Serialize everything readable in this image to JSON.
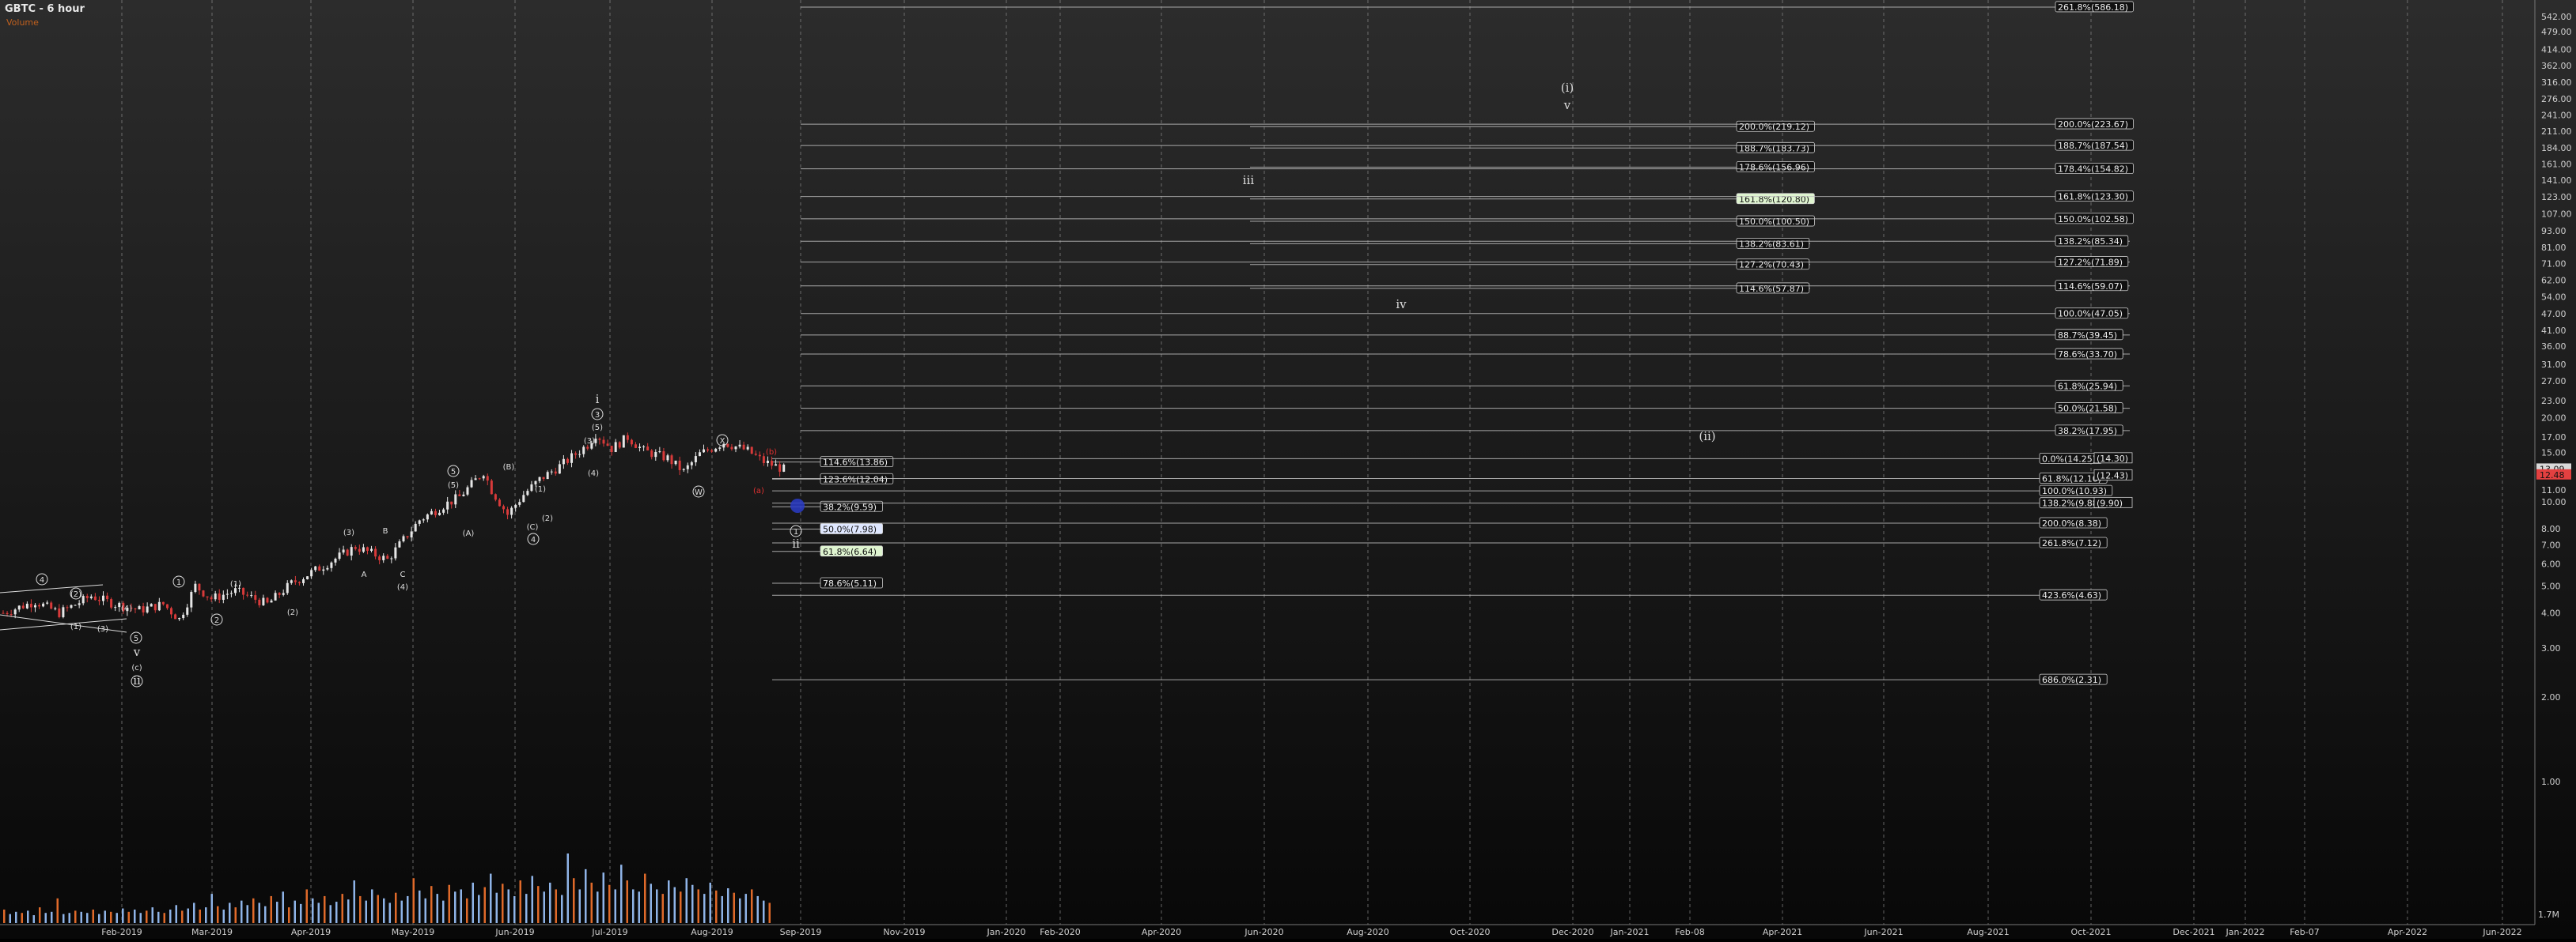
{
  "chart": {
    "title": "GBTC - 6 hour",
    "indicator_label": "Volume",
    "volume_readout": "1.7M"
  },
  "colors": {
    "background_top": "#2a2a2a",
    "background_bottom": "#0a0a0a",
    "grid": "#8a8a8a",
    "up_candle": "#e6e6e6",
    "down_candle": "#d83a3a",
    "volume_up": "#8fb4e8",
    "volume_down": "#e06a2a",
    "fib_line": "#bfbfbf",
    "label_bg": "#111111",
    "label_text": "#eeeeee",
    "highlight_green": "#dff5d0",
    "highlight_blue": "#dfe7ff",
    "wave_label": "#dddddd",
    "red_label": "#e03030",
    "price_tag_bg": "#d9d9d9"
  },
  "chart_data": {
    "type": "candlestick",
    "title": "GBTC - 6 hour",
    "y_scale": "log",
    "ylim": [
      0.9,
      586
    ],
    "x_tick_labels": [
      "Feb-2019",
      "Mar-2019",
      "Apr-2019",
      "May-2019",
      "Jun-2019",
      "Jul-2019",
      "Aug-2019",
      "Sep-2019",
      "Nov-2019",
      "Jan-2020",
      "Feb-2020",
      "Apr-2020",
      "Jun-2020",
      "Aug-2020",
      "Oct-2020",
      "Dec-2020",
      "Jan-2021",
      "Feb-08",
      "Apr-2021",
      "Jun-2021",
      "Aug-2021",
      "Oct-2021",
      "Dec-2021",
      "Jan-2022",
      "Feb-07",
      "Apr-2022",
      "Jun-2022"
    ],
    "y_tick_labels": [
      "542.00",
      "479.00",
      "414.00",
      "362.00",
      "316.00",
      "276.00",
      "241.00",
      "211.00",
      "184.00",
      "161.00",
      "141.00",
      "123.00",
      "107.00",
      "93.00",
      "81.00",
      "71.00",
      "62.00",
      "54.00",
      "47.00",
      "41.00",
      "36.00",
      "31.00",
      "27.00",
      "23.00",
      "20.00",
      "17.00",
      "15.00",
      "13.00",
      "11.00",
      "10.00",
      "8.00",
      "7.00",
      "6.00",
      "5.00",
      "4.00",
      "3.00",
      "2.00",
      "1.00"
    ],
    "y_tick_values": [
      542,
      479,
      414,
      362,
      316,
      276,
      241,
      211,
      184,
      161,
      141,
      123,
      107,
      93,
      81,
      71,
      62,
      54,
      47,
      41,
      36,
      31,
      27,
      23,
      20,
      17,
      15,
      13,
      11,
      10,
      8,
      7,
      6,
      5,
      4,
      3,
      2,
      1
    ],
    "price_path": [
      [
        0,
        4.0
      ],
      [
        8,
        4.4
      ],
      [
        14,
        4.0
      ],
      [
        22,
        4.6
      ],
      [
        28,
        4.3
      ],
      [
        34,
        4.1
      ],
      [
        40,
        4.3
      ],
      [
        44,
        3.8
      ],
      [
        48,
        5.0
      ],
      [
        52,
        4.5
      ],
      [
        58,
        4.8
      ],
      [
        66,
        4.3
      ],
      [
        72,
        5.1
      ],
      [
        80,
        5.9
      ],
      [
        88,
        6.9
      ],
      [
        96,
        6.2
      ],
      [
        104,
        8.6
      ],
      [
        110,
        9.7
      ],
      [
        114,
        10.4
      ],
      [
        120,
        12.8
      ],
      [
        122,
        11.0
      ],
      [
        126,
        9.0
      ],
      [
        130,
        10.6
      ],
      [
        134,
        12.0
      ],
      [
        140,
        13.7
      ],
      [
        146,
        16.0
      ],
      [
        148,
        17.5
      ],
      [
        152,
        15.5
      ],
      [
        156,
        17.0
      ],
      [
        160,
        15.2
      ],
      [
        166,
        14.3
      ],
      [
        170,
        12.8
      ],
      [
        174,
        14.8
      ],
      [
        180,
        16.3
      ],
      [
        186,
        15.2
      ],
      [
        190,
        13.9
      ],
      [
        196,
        12.9
      ]
    ],
    "volume": [
      12,
      8,
      10,
      9,
      11,
      7,
      14,
      9,
      10,
      22,
      8,
      9,
      11,
      10,
      9,
      12,
      8,
      11,
      10,
      9,
      13,
      10,
      12,
      9,
      11,
      14,
      10,
      9,
      12,
      16,
      11,
      13,
      18,
      12,
      14,
      26,
      15,
      12,
      18,
      14,
      20,
      16,
      22,
      18,
      15,
      24,
      19,
      28,
      14,
      20,
      17,
      30,
      22,
      18,
      24,
      16,
      19,
      26,
      21,
      38,
      24,
      20,
      30,
      25,
      22,
      18,
      27,
      20,
      24,
      40,
      29,
      22,
      33,
      26,
      20,
      34,
      28,
      30,
      22,
      36,
      25,
      32,
      44,
      27,
      35,
      30,
      24,
      38,
      26,
      42,
      33,
      28,
      36,
      30,
      25,
      62,
      40,
      30,
      48,
      36,
      28,
      45,
      34,
      30,
      52,
      38,
      30,
      28,
      44,
      35,
      30,
      26,
      38,
      32,
      28,
      40,
      34,
      30,
      26,
      36,
      29,
      24,
      31,
      27,
      22,
      26,
      30,
      24,
      20,
      18
    ],
    "fib_sets": [
      {
        "x_start_date": "Aug-2019",
        "items": [
          {
            "label": "114.6%(13.86)",
            "price": 13.86
          },
          {
            "label": "123.6%(12.04)",
            "price": 12.04
          },
          {
            "label": "38.2%(9.59)",
            "price": 9.59
          },
          {
            "label": "50.0%(7.98)",
            "price": 7.98,
            "highlight": "blue"
          },
          {
            "label": "61.8%(6.64)",
            "price": 6.64,
            "highlight": "green"
          },
          {
            "label": "78.6%(5.11)",
            "price": 5.11
          }
        ]
      },
      {
        "x_start_date": "Jun-2020",
        "items": [
          {
            "label": "200.0%(219.12)",
            "price": 219.12
          },
          {
            "label": "188.7%(183.73)",
            "price": 183.73
          },
          {
            "label": "178.6%(156.96)",
            "price": 156.96
          },
          {
            "label": "161.8%(120.80)",
            "price": 120.8,
            "highlight": "green"
          },
          {
            "label": "150.0%(100.50)",
            "price": 100.5
          },
          {
            "label": "138.2%(83.61)",
            "price": 83.61
          },
          {
            "label": "127.2%(70.43)",
            "price": 70.43
          },
          {
            "label": "114.6%(57.87)",
            "price": 57.87
          }
        ]
      },
      {
        "x_start_date": "Sep-2019",
        "items": [
          {
            "label": "261.8%(586.18)",
            "price": 586.18
          },
          {
            "label": "200.0%(223.67)",
            "price": 223.67
          },
          {
            "label": "188.7%(187.54)",
            "price": 187.54
          },
          {
            "label": "178.4%(154.82)",
            "price": 154.82
          },
          {
            "label": "161.8%(123.30)",
            "price": 123.3
          },
          {
            "label": "150.0%(102.58)",
            "price": 102.58
          },
          {
            "label": "138.2%(85.34)",
            "price": 85.34
          },
          {
            "label": "127.2%(71.89)",
            "price": 71.89
          },
          {
            "label": "114.6%(59.07)",
            "price": 59.07
          },
          {
            "label": "100.0%(47.05)",
            "price": 47.05
          },
          {
            "label": "88.7%(39.45)",
            "price": 39.45
          },
          {
            "label": "78.6%(33.70)",
            "price": 33.7
          },
          {
            "label": "61.8%(25.94)",
            "price": 25.94
          },
          {
            "label": "50.0%(21.58)",
            "price": 21.58
          },
          {
            "label": "38.2%(17.95)",
            "price": 17.95
          }
        ]
      },
      {
        "x_start_date": "Sep-2019",
        "items": [
          {
            "label": "0.0%(14.25)",
            "price": 14.25
          },
          {
            "label": "61.8%(12.10)",
            "price": 12.1
          },
          {
            "label": "100.0%(10.93)",
            "price": 10.93
          },
          {
            "label": "138.2%(9.88)",
            "price": 9.88
          },
          {
            "label": "200.0%(8.38)",
            "price": 8.38
          },
          {
            "label": "261.8%(7.12)",
            "price": 7.12
          },
          {
            "label": "423.6%(4.63)",
            "price": 4.63
          },
          {
            "label": "686.0%(2.31)",
            "price": 2.31
          }
        ]
      }
    ],
    "right_tags": [
      {
        "label": "(14.30)",
        "price": 14.3
      },
      {
        "label": "(12.43)",
        "price": 12.43
      },
      {
        "label": "(9.90)",
        "price": 9.9
      }
    ],
    "price_tags": [
      {
        "label": "13.09",
        "price": 13.09
      },
      {
        "label": "12.48",
        "price": 12.48,
        "color": "red"
      }
    ],
    "wave_labels": [
      {
        "text": "4",
        "circle": true,
        "x": 53,
        "y": 737
      },
      {
        "text": "(2)",
        "circle": true,
        "x": 96,
        "y": 755
      },
      {
        "text": "(1)",
        "circle": false,
        "x": 96,
        "y": 796
      },
      {
        "text": "(3)",
        "circle": false,
        "x": 130,
        "y": 799
      },
      {
        "text": "(4)",
        "circle": false,
        "x": 160,
        "y": 773
      },
      {
        "text": "5",
        "circle": true,
        "x": 172,
        "y": 811
      },
      {
        "text": "v",
        "circle": false,
        "x": 173,
        "y": 830
      },
      {
        "text": "(c)",
        "circle": false,
        "x": 173,
        "y": 848
      },
      {
        "text": "ii",
        "circle": true,
        "x": 173,
        "y": 866
      },
      {
        "text": "1",
        "circle": true,
        "x": 226,
        "y": 740
      },
      {
        "text": "2",
        "circle": true,
        "x": 274,
        "y": 788
      },
      {
        "text": "(1)",
        "circle": false,
        "x": 298,
        "y": 742
      },
      {
        "text": "(2)",
        "circle": false,
        "x": 370,
        "y": 778
      },
      {
        "text": "(3)",
        "circle": false,
        "x": 441,
        "y": 677
      },
      {
        "text": "A",
        "circle": false,
        "x": 460,
        "y": 730
      },
      {
        "text": "B",
        "circle": false,
        "x": 487,
        "y": 675
      },
      {
        "text": "C",
        "circle": false,
        "x": 509,
        "y": 730
      },
      {
        "text": "(4)",
        "circle": false,
        "x": 509,
        "y": 746
      },
      {
        "text": "5",
        "circle": true,
        "x": 573,
        "y": 600
      },
      {
        "text": "(5)",
        "circle": false,
        "x": 573,
        "y": 617
      },
      {
        "text": "(A)",
        "circle": false,
        "x": 592,
        "y": 678
      },
      {
        "text": "(B)",
        "circle": false,
        "x": 643,
        "y": 594
      },
      {
        "text": "(C)",
        "circle": false,
        "x": 673,
        "y": 670
      },
      {
        "text": "4",
        "circle": true,
        "x": 674,
        "y": 686
      },
      {
        "text": "(1)",
        "circle": false,
        "x": 683,
        "y": 622
      },
      {
        "text": "(2)",
        "circle": false,
        "x": 692,
        "y": 659
      },
      {
        "text": "(3)",
        "circle": false,
        "x": 745,
        "y": 561
      },
      {
        "text": "(4)",
        "circle": false,
        "x": 750,
        "y": 602
      },
      {
        "text": "i",
        "circle": false,
        "x": 755,
        "y": 510
      },
      {
        "text": "3",
        "circle": true,
        "x": 755,
        "y": 528
      },
      {
        "text": "(5)",
        "circle": false,
        "x": 755,
        "y": 544
      },
      {
        "text": "X",
        "circle": true,
        "x": 913,
        "y": 561
      },
      {
        "text": "W",
        "circle": true,
        "x": 883,
        "y": 626
      },
      {
        "text": "(b)",
        "circle": false,
        "x": 975,
        "y": 575,
        "red": true
      },
      {
        "text": "(a)",
        "circle": false,
        "x": 959,
        "y": 624,
        "red": true
      },
      {
        "text": "1",
        "circle": true,
        "x": 1006,
        "y": 676
      },
      {
        "text": "ii",
        "circle": false,
        "x": 1006,
        "y": 693
      },
      {
        "text": "iii",
        "circle": false,
        "x": 1578,
        "y": 233
      },
      {
        "text": "iv",
        "circle": false,
        "x": 1771,
        "y": 390
      },
      {
        "text": "(i)",
        "circle": false,
        "x": 1981,
        "y": 116
      },
      {
        "text": "v",
        "circle": false,
        "x": 1981,
        "y": 138
      },
      {
        "text": "(ii)",
        "circle": false,
        "x": 2158,
        "y": 557
      }
    ]
  }
}
